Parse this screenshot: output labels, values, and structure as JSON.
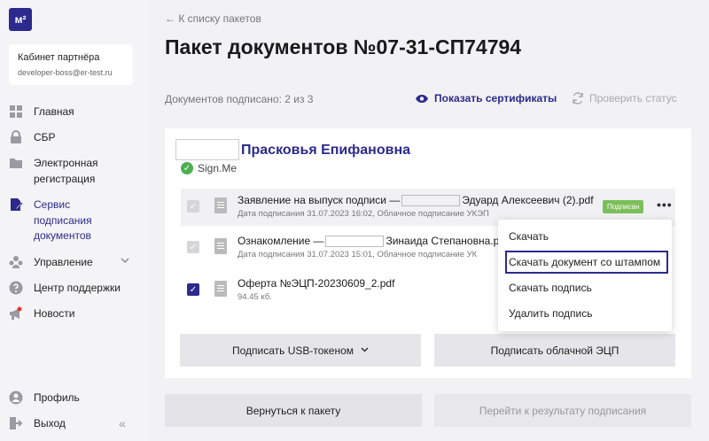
{
  "sidebar": {
    "logo": "м²",
    "partner_title": "Кабинет партнёра",
    "partner_email": "developer-boss@er-test.ru",
    "items": [
      {
        "label": "Главная",
        "icon": "grid-icon"
      },
      {
        "label": "СБР",
        "icon": "lock-icon"
      },
      {
        "label": "Электронная регистрация",
        "icon": "folder-icon"
      },
      {
        "label": "Сервис подписания документов",
        "icon": "document-sign-icon"
      },
      {
        "label": "Управление",
        "icon": "users-icon"
      },
      {
        "label": "Центр поддержки",
        "icon": "help-icon"
      },
      {
        "label": "Новости",
        "icon": "megaphone-icon"
      }
    ],
    "profile_label": "Профиль",
    "logout_label": "Выход",
    "collapse_glyph": "«"
  },
  "header": {
    "back_link": "← К списку пакетов",
    "title": "Пакет документов №07-31-СП74794",
    "signed_count": "Документов подписано: 2 из 3",
    "show_certificates": "Показать сертификаты",
    "check_status": "Проверить статус"
  },
  "signer": {
    "name": "Прасковья Епифановна",
    "method": "Sign.Me"
  },
  "documents": [
    {
      "title_prefix": "Заявление на выпуск подписи —",
      "title_suffix": "Эдуард Алексеевич (2).pdf",
      "subtitle": "Дата подписания 31.07.2023 16:02, Облачное подписание УКЭП",
      "badge": "Подписан",
      "checked": true
    },
    {
      "title_prefix": "Ознакомление —",
      "title_suffix": "Зинаида Степановна.pdf",
      "subtitle": "Дата подписания 31.07.2023 15:01, Облачное подписание УК",
      "checked": true
    },
    {
      "title": "Оферта №ЭЦП-20230609_2.pdf",
      "subtitle": "94.45 кб.",
      "checked": true
    }
  ],
  "more_glyph": "•••",
  "check_glyph": "✓",
  "actions": {
    "sign_usb": "Подписать USB-токеном",
    "sign_cloud": "Подписать облачной ЭЦП",
    "back_to_package": "Вернуться к пакету",
    "go_to_result": "Перейти к результату подписания",
    "chevron": "⌄"
  },
  "context_menu": {
    "items": [
      "Скачать",
      "Скачать документ со штампом",
      "Скачать подпись",
      "Удалить подпись"
    ]
  },
  "colors": {
    "accent": "#2c2a8c",
    "success": "#4caf50",
    "badge": "#7cbf5a"
  }
}
